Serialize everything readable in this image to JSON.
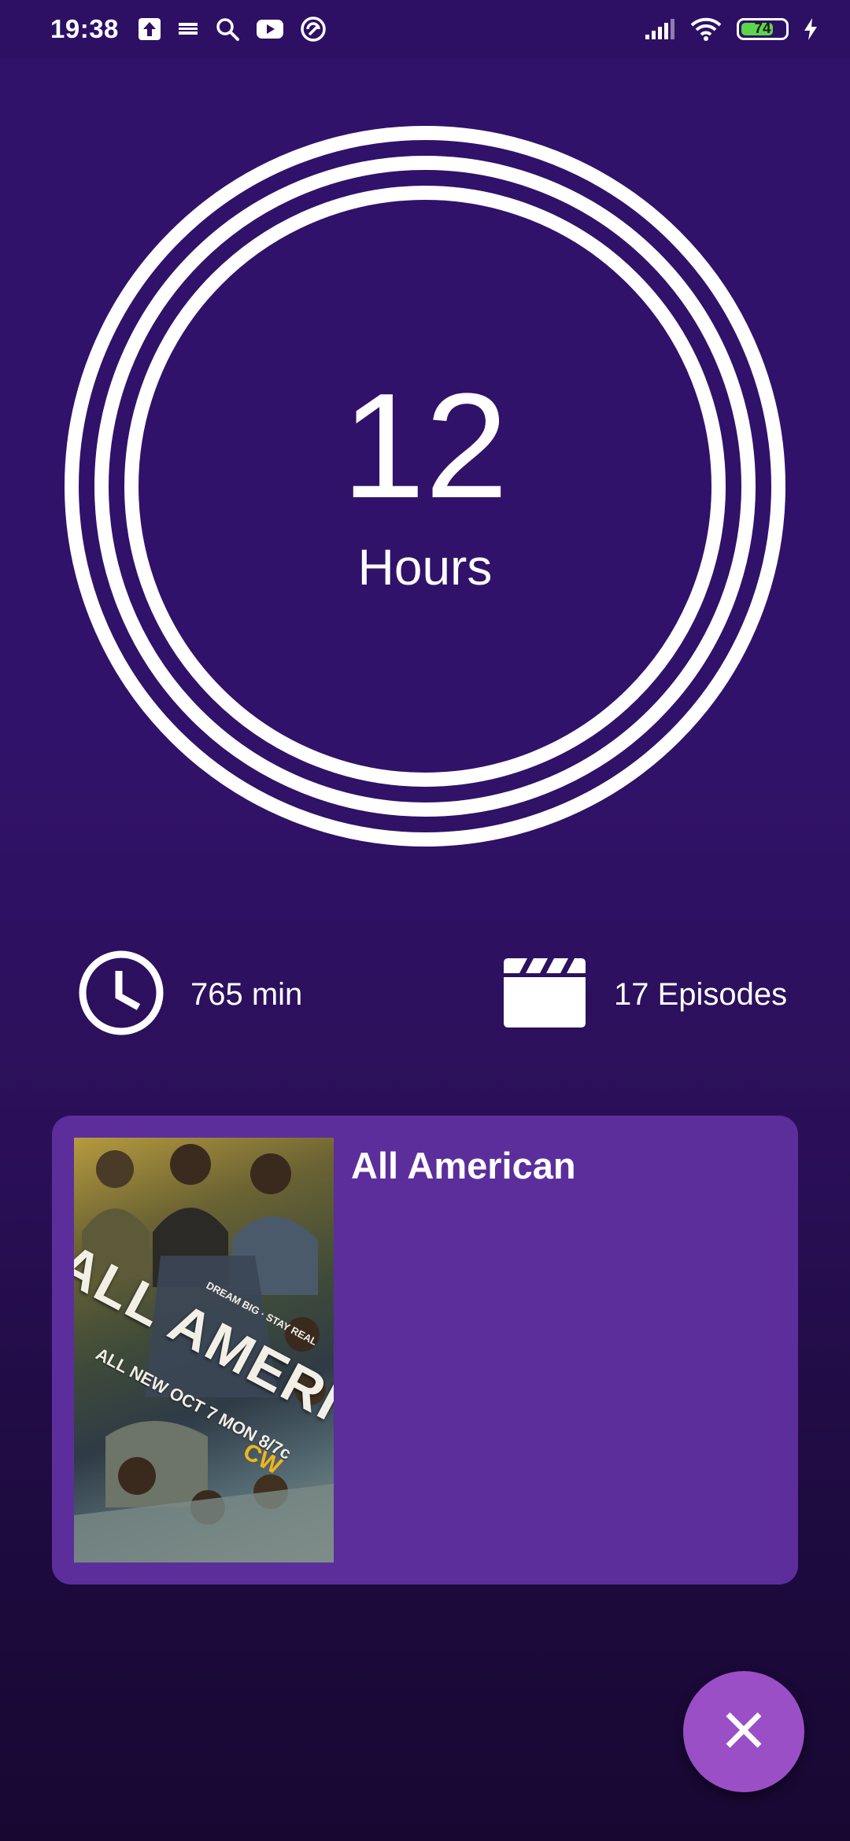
{
  "status_bar": {
    "time": "19:38",
    "left_icons": [
      "upload-icon",
      "app-notification-icon",
      "search-icon",
      "youtube-icon",
      "sync-icon"
    ],
    "right_icons": [
      "signal-icon",
      "wifi-icon",
      "battery-icon",
      "charging-icon"
    ],
    "battery_level": "74",
    "battery_fraction": 0.74
  },
  "summary": {
    "value": "12",
    "unit": "Hours"
  },
  "stats": {
    "minutes_label": "765 min",
    "minutes_icon": "clock-icon",
    "episodes_label": "17 Episodes",
    "episodes_icon": "clapperboard-icon"
  },
  "shows": [
    {
      "title": "All American",
      "poster": {
        "title": "ALL AMERICAN",
        "tagline": "DREAM BIG · STAY REAL",
        "airdate": "ALL NEW OCT 7 MON 8/7c",
        "network": "CW"
      }
    }
  ],
  "fab": {
    "icon": "close-icon"
  },
  "colors": {
    "background": "#31126a",
    "status_bar": "#2d1064",
    "card": "#5b2e9c",
    "fab": "#9b4fc6",
    "rings": "#ffffff",
    "battery": "#5bd64b"
  }
}
